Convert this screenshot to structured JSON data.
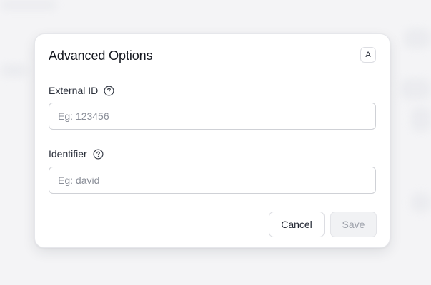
{
  "modal": {
    "title": "Advanced Options",
    "shortcut_badge": "A"
  },
  "fields": {
    "external_id": {
      "label": "External ID",
      "placeholder": "Eg: 123456",
      "value": "",
      "help_icon": "question-circle-icon"
    },
    "identifier": {
      "label": "Identifier",
      "placeholder": "Eg: david",
      "value": "",
      "help_icon": "question-circle-icon"
    }
  },
  "actions": {
    "cancel_label": "Cancel",
    "save_label": "Save",
    "save_disabled": true
  }
}
